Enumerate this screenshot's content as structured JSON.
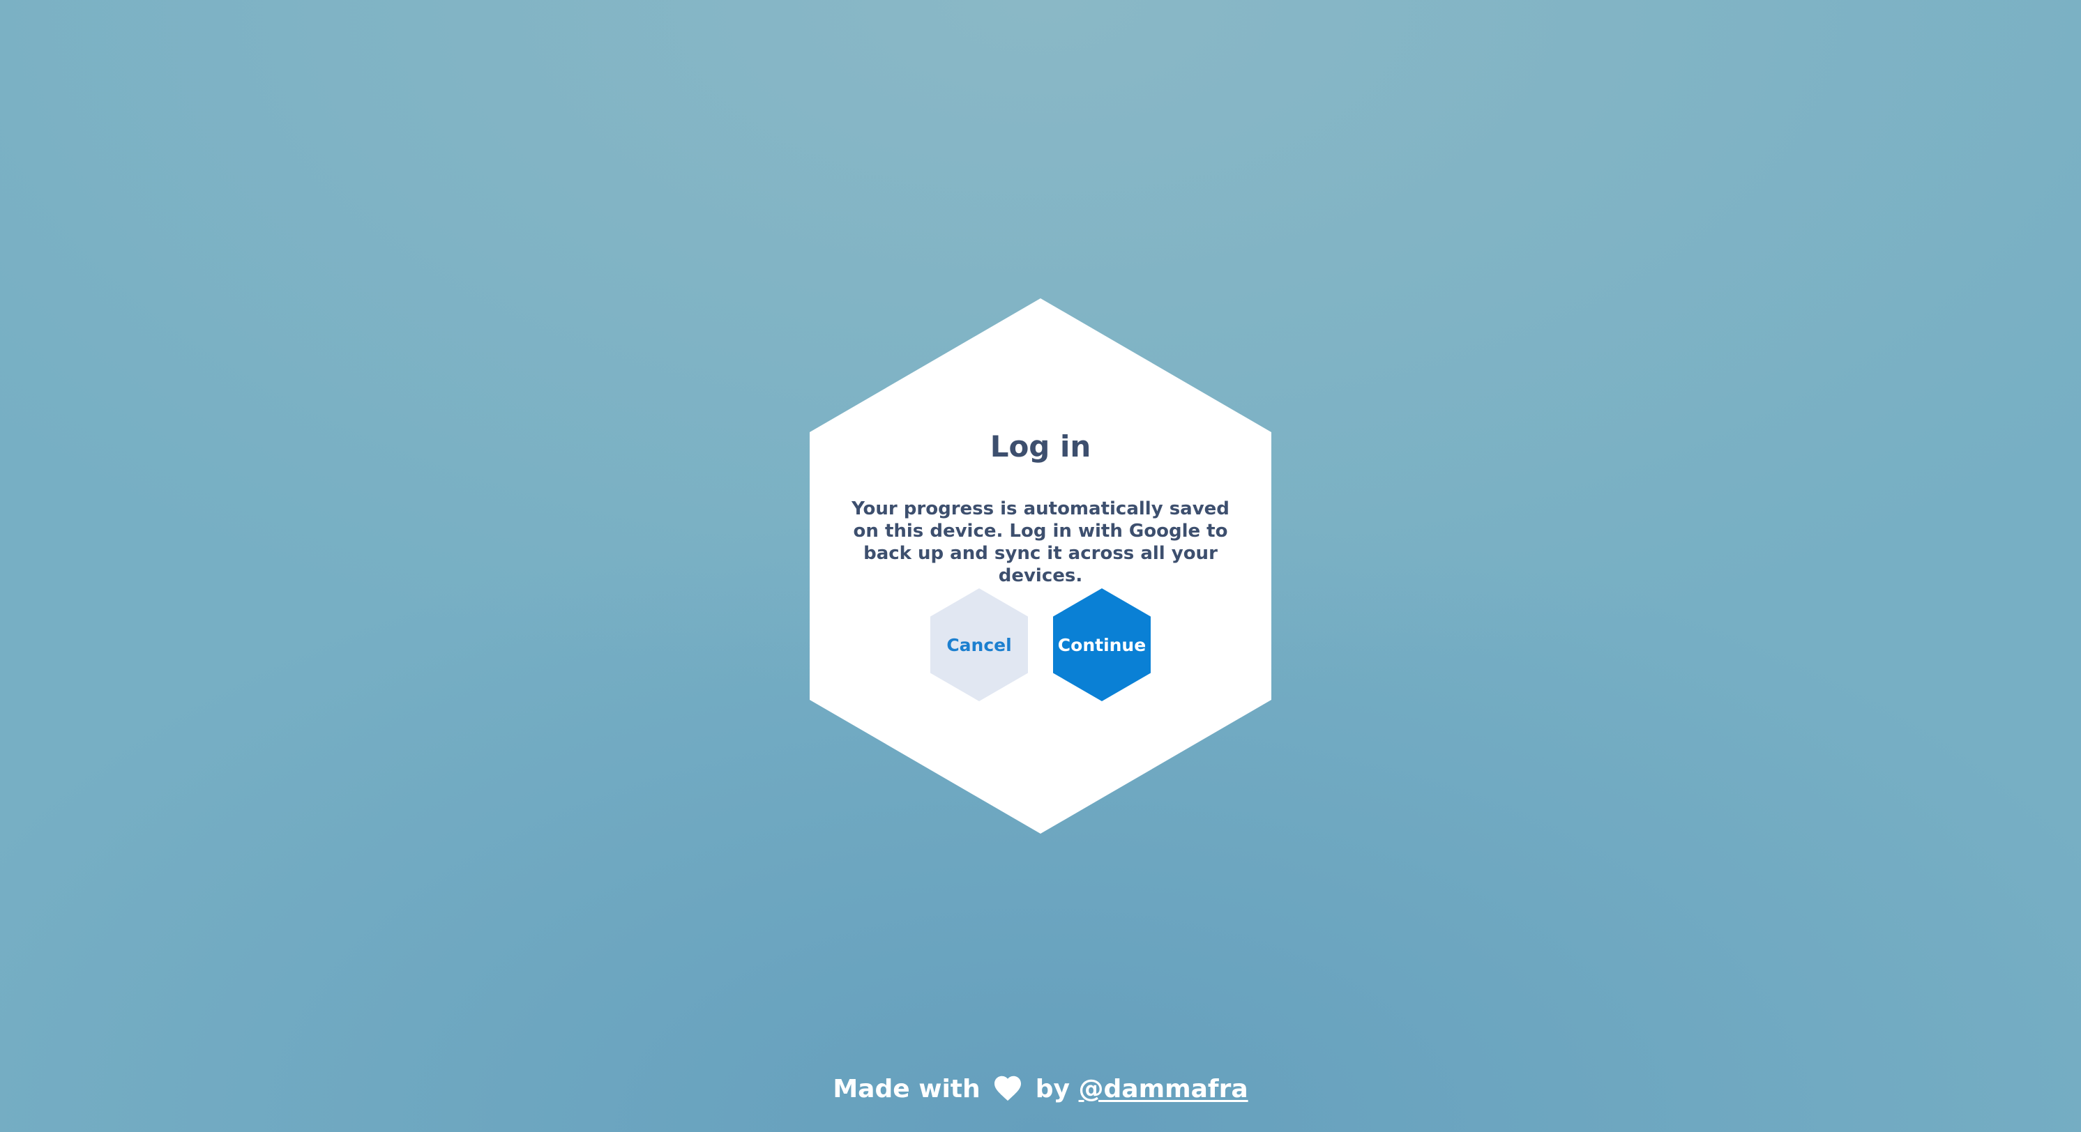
{
  "login_modal": {
    "title": "Log in",
    "message": "Your progress is automatically saved on this device. Log in with Google to back up and sync it across all your devices.",
    "cancel_label": "Cancel",
    "continue_label": "Continue"
  },
  "footer": {
    "made_with": "Made with",
    "by": "by",
    "author_link": "@dammafra",
    "heart_icon": "heart-icon"
  },
  "colors": {
    "background": "#77afc4",
    "modal_background": "#ffffff",
    "text": "#3d4f6e",
    "primary": "#0a80d5",
    "secondary": "#e1e7f2"
  }
}
